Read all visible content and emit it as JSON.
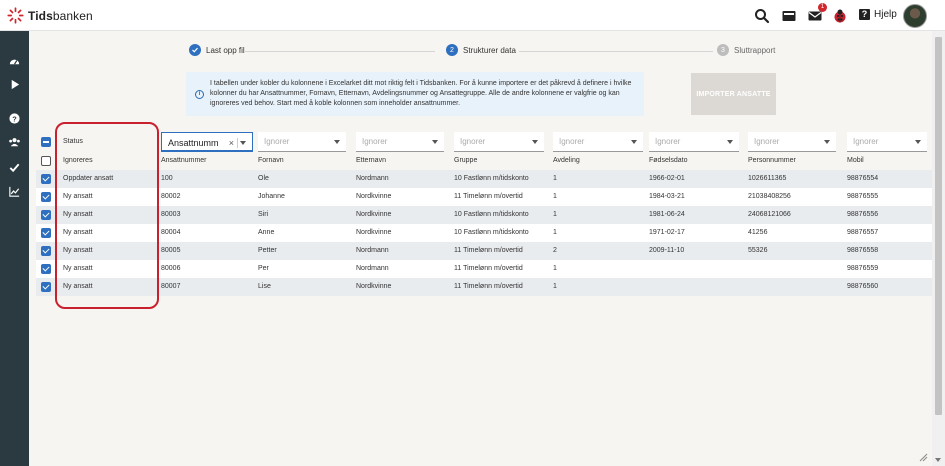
{
  "header": {
    "brand": "Tidsbanken",
    "brand_bold": "Tids",
    "brand_rest": "banken",
    "notification_count": "1",
    "help_label": "Hjelp",
    "icons": [
      "search-icon",
      "inbox-icon",
      "mail-icon",
      "ladybug-icon",
      "help-icon"
    ]
  },
  "sidebar": {
    "icons": [
      "dashboard-icon",
      "play-icon",
      "help-icon",
      "users-icon",
      "check-icon",
      "chart-icon"
    ]
  },
  "steps": [
    {
      "label": "Last opp fil",
      "state": "done"
    },
    {
      "label": "Strukturer data",
      "number": "2",
      "state": "active"
    },
    {
      "label": "Sluttrapport",
      "number": "3",
      "state": "pending"
    }
  ],
  "info": {
    "text": "I tabellen under kobler du kolonnene i Excelarket ditt mot riktig felt i Tidsbanken. For å kunne importere er det påkrevd å definere i hvilke kolonner du har Ansattnummer, Fornavn, Etternavn, Avdelingsnummer og Ansattegruppe. Alle de andre kolonnene er valgfrie og kan ignoreres ved behov. Start med å koble kolonnen som inneholder ansattnummer."
  },
  "import_button": "IMPORTER ANSATTE",
  "table": {
    "status_header": "Status",
    "mapping": [
      {
        "value": "Ansattnumm",
        "active": true
      },
      {
        "value": "Ignorer"
      },
      {
        "value": "Ignorer"
      },
      {
        "value": "Ignorer"
      },
      {
        "value": "Ignorer"
      },
      {
        "value": "Ignorer"
      },
      {
        "value": "Ignorer"
      },
      {
        "value": "Ignorer"
      }
    ],
    "header_row": {
      "status": "Ignoreres",
      "cells": [
        "Ansattnummer",
        "Fornavn",
        "Etternavn",
        "Gruppe",
        "Avdeling",
        "Fødselsdato",
        "Personnummer",
        "Mobil"
      ]
    },
    "rows": [
      {
        "status": "Oppdater ansatt",
        "cells": [
          "100",
          "Ole",
          "Nordmann",
          "10 Fastlønn m/tidskonto",
          "1",
          "1966-02-01",
          "1026611365",
          "98876554"
        ]
      },
      {
        "status": "Ny ansatt",
        "cells": [
          "80002",
          "Johanne",
          "Nordkvinne",
          "11 Timelønn m/overtid",
          "1",
          "1984-03-21",
          "21038408256",
          "98876555"
        ]
      },
      {
        "status": "Ny ansatt",
        "cells": [
          "80003",
          "Siri",
          "Nordkvinne",
          "10 Fastlønn m/tidskonto",
          "1",
          "1981-06-24",
          "24068121066",
          "98876556"
        ]
      },
      {
        "status": "Ny ansatt",
        "cells": [
          "80004",
          "Anne",
          "Nordkvinne",
          "10 Fastlønn m/tidskonto",
          "1",
          "1971-02-17",
          "41256",
          "98876557"
        ]
      },
      {
        "status": "Ny ansatt",
        "cells": [
          "80005",
          "Petter",
          "Nordmann",
          "11 Timelønn m/overtid",
          "2",
          "2009-11-10",
          "55326",
          "98876558"
        ]
      },
      {
        "status": "Ny ansatt",
        "cells": [
          "80006",
          "Per",
          "Nordmann",
          "11 Timelønn m/overtid",
          "1",
          "",
          "",
          "98876559"
        ]
      },
      {
        "status": "Ny ansatt",
        "cells": [
          "80007",
          "Lise",
          "Nordkvinne",
          "11 Timelønn m/overtid",
          "1",
          "",
          "",
          "98876560"
        ]
      }
    ]
  },
  "colors": {
    "accent": "#2f6fbf",
    "sidebar": "#2b3a40",
    "highlight": "#c9202e",
    "brand_red": "#d0262d"
  }
}
